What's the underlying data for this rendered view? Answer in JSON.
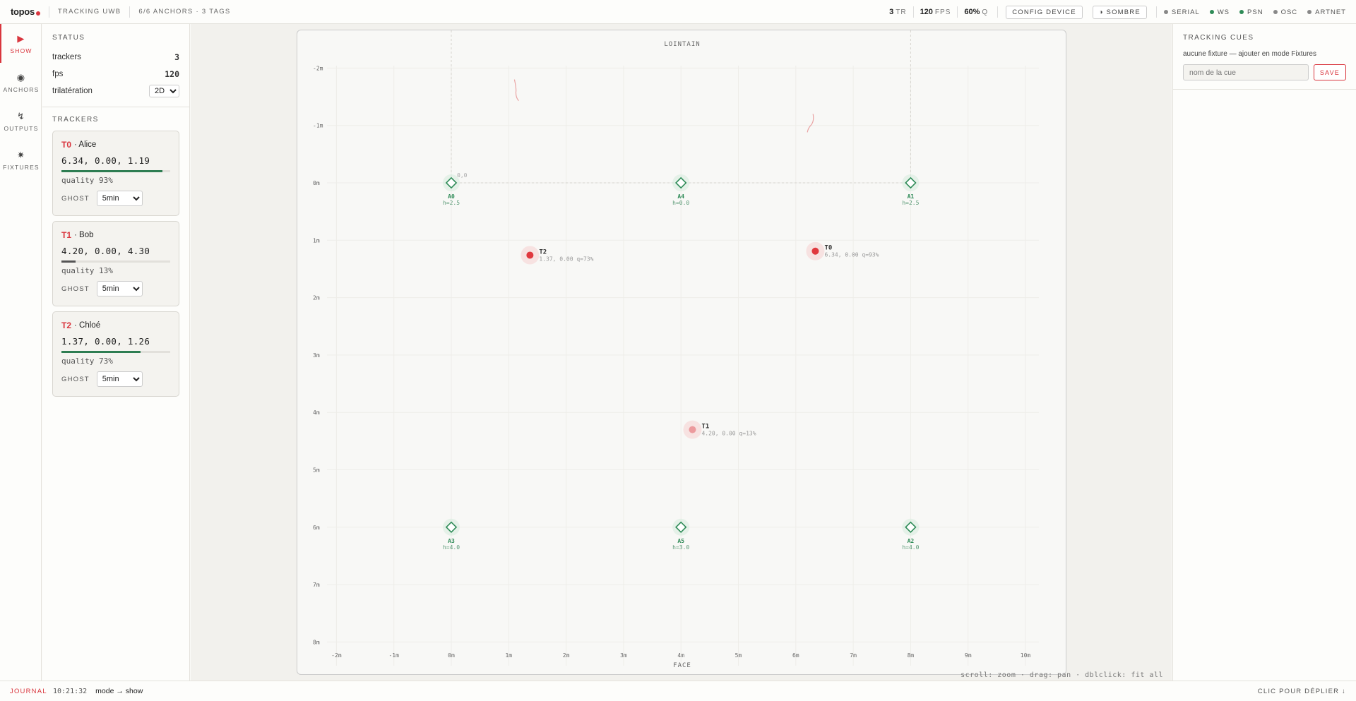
{
  "topbar": {
    "logo": "topos",
    "title": "TRACKING UWB",
    "summary": "6/6 ANCHORS · 3 TAGS",
    "stats": [
      {
        "value": "3",
        "unit": "TR"
      },
      {
        "value": "120",
        "unit": "FPS"
      },
      {
        "value": "60%",
        "unit": "Q"
      }
    ],
    "config_label": "CONFIG DEVICE",
    "theme_label": "◑ SOMBRE",
    "outputs": [
      {
        "label": "SERIAL",
        "color": "#888888"
      },
      {
        "label": "WS",
        "color": "#2e8b57"
      },
      {
        "label": "PSN",
        "color": "#2e8b57"
      },
      {
        "label": "OSC",
        "color": "#888888"
      },
      {
        "label": "ARTNET",
        "color": "#888888"
      }
    ]
  },
  "nav": [
    {
      "label": "SHOW",
      "icon": "play-icon",
      "glyph": "▶",
      "active": true
    },
    {
      "label": "ANCHORS",
      "icon": "target-icon",
      "glyph": "◉",
      "active": false
    },
    {
      "label": "OUTPUTS",
      "icon": "signal-icon",
      "glyph": "↯",
      "active": false
    },
    {
      "label": "FIXTURES",
      "icon": "spotlight-icon",
      "glyph": "✷",
      "active": false
    }
  ],
  "status": {
    "title": "STATUS",
    "trackers_label": "trackers",
    "trackers_value": "3",
    "fps_label": "fps",
    "fps_value": "120",
    "tril_label": "trilatération",
    "tril_value": "2D"
  },
  "trackers": {
    "title": "TRACKERS",
    "ghost_label": "GHOST",
    "items": [
      {
        "id": "T0",
        "name": "· Alice",
        "pos": "6.34, 0.00, 1.19",
        "quality_text": "quality 93%",
        "quality": 0.93,
        "bar_color": "#2e7d52",
        "ghost": "5min"
      },
      {
        "id": "T1",
        "name": "· Bob",
        "pos": "4.20, 0.00, 4.30",
        "quality_text": "quality 13%",
        "quality": 0.13,
        "bar_color": "#555555",
        "ghost": "5min"
      },
      {
        "id": "T2",
        "name": "· Chloé",
        "pos": "1.37, 0.00, 1.26",
        "quality_text": "quality 73%",
        "quality": 0.73,
        "bar_color": "#2e7d52",
        "ghost": "5min"
      }
    ]
  },
  "map": {
    "top_label": "LOINTAIN",
    "bottom_label": "FACE",
    "hint": "scroll: zoom · drag: pan · dblclick: fit all",
    "origin_label": "0,0",
    "x_ticks": [
      "-2m",
      "-1m",
      "0m",
      "1m",
      "2m",
      "3m",
      "4m",
      "5m",
      "6m",
      "7m",
      "8m",
      "9m",
      "10m"
    ],
    "y_ticks": [
      "-2m",
      "-1m",
      "0m",
      "1m",
      "2m",
      "3m",
      "4m",
      "5m",
      "6m",
      "7m",
      "8m"
    ],
    "anchors": [
      {
        "id": "A0",
        "h": "h=2.5",
        "x": 0,
        "z": 0
      },
      {
        "id": "A4",
        "h": "h=0.0",
        "x": 4,
        "z": 0
      },
      {
        "id": "A1",
        "h": "h=2.5",
        "x": 8,
        "z": 0
      },
      {
        "id": "A3",
        "h": "h=4.0",
        "x": 0,
        "z": 6
      },
      {
        "id": "A5",
        "h": "h=3.0",
        "x": 4,
        "z": 6
      },
      {
        "id": "A2",
        "h": "h=4.0",
        "x": 8,
        "z": 6
      }
    ],
    "tags": [
      {
        "id": "T0",
        "info": "6.34, 0.00  q=93%",
        "x": 6.34,
        "z": 1.19,
        "strong": true
      },
      {
        "id": "T1",
        "info": "4.20, 0.00  q=13%",
        "x": 4.2,
        "z": 4.3,
        "strong": false
      },
      {
        "id": "T2",
        "info": "1.37, 0.00  q=73%",
        "x": 1.37,
        "z": 1.26,
        "strong": true
      }
    ]
  },
  "cues": {
    "title": "TRACKING CUES",
    "hint": "aucune fixture — ajouter en mode Fixtures",
    "placeholder": "nom de la cue",
    "save_label": "SAVE"
  },
  "journal": {
    "label": "JOURNAL",
    "time": "10:21:32",
    "message": "mode → show",
    "expand_label": "CLIC POUR DÉPLIER ↓"
  }
}
